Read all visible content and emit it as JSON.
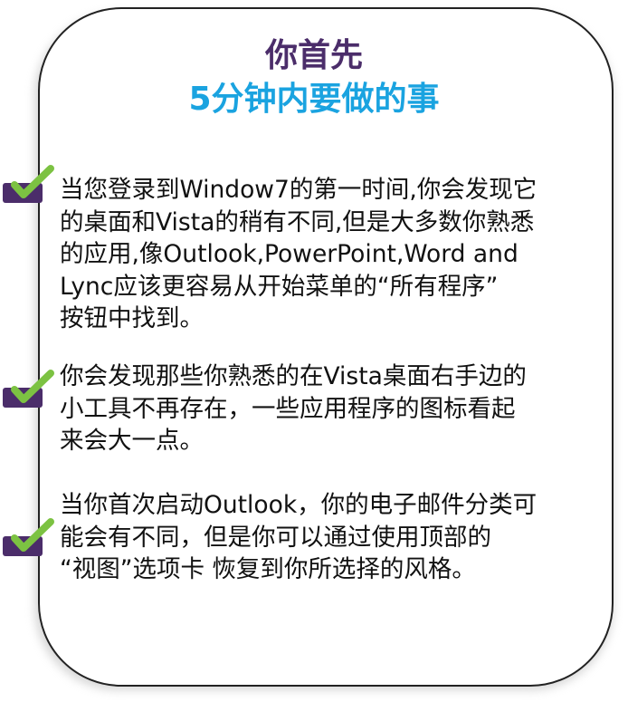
{
  "title": {
    "line1": "你首先",
    "line2": "5分钟内要做的事"
  },
  "colors": {
    "title_line1": "#4b2d6a",
    "title_line2": "#1aa3e0",
    "check_box": "#4b2d6a",
    "check_mark": "#7cc242",
    "border": "#222222"
  },
  "items": [
    {
      "icon": "checkmark-icon",
      "lines": [
        "当您登录到Window7的第一时间,你会发现它",
        "的桌面和Vista的稍有不同,但是大多数你熟悉",
        "的应用,像Outlook,PowerPoint,Word and",
        "Lync应该更容易从开始菜单的“所有程序”",
        "按钮中找到。"
      ]
    },
    {
      "icon": "checkmark-icon",
      "lines": [
        "你会发现那些你熟悉的在Vista桌面右手边的",
        "小工具不再存在，一些应用程序的图标看起",
        "来会大一点。"
      ]
    },
    {
      "icon": "checkmark-icon",
      "lines": [
        "当你首次启动Outlook，你的电子邮件分类可",
        "能会有不同，但是你可以通过使用顶部的",
        "“视图”选项卡  恢复到你所选择的风格。"
      ]
    }
  ]
}
